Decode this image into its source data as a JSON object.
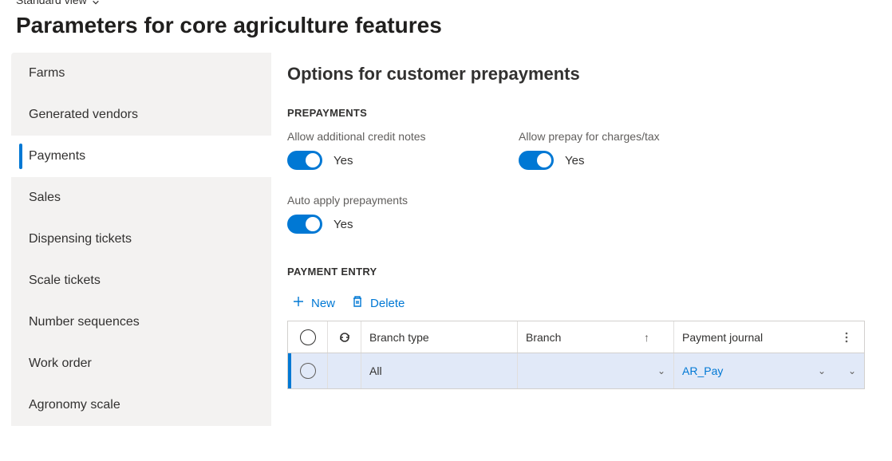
{
  "view_mode": "Standard view",
  "page_title": "Parameters for core agriculture features",
  "sidebar": {
    "items": [
      {
        "label": "Farms"
      },
      {
        "label": "Generated vendors"
      },
      {
        "label": "Payments"
      },
      {
        "label": "Sales"
      },
      {
        "label": "Dispensing tickets"
      },
      {
        "label": "Scale tickets"
      },
      {
        "label": "Number sequences"
      },
      {
        "label": "Work order"
      },
      {
        "label": "Agronomy scale"
      }
    ],
    "active_index": 2
  },
  "main": {
    "title": "Options for customer prepayments",
    "sections": {
      "prepayments": {
        "label": "PREPAYMENTS",
        "toggles": {
          "allow_credit_notes": {
            "label": "Allow additional credit notes",
            "value": "Yes",
            "on": true
          },
          "allow_prepay_charges": {
            "label": "Allow prepay for charges/tax",
            "value": "Yes",
            "on": true
          },
          "auto_apply": {
            "label": "Auto apply prepayments",
            "value": "Yes",
            "on": true
          }
        }
      },
      "payment_entry": {
        "label": "PAYMENT ENTRY",
        "toolbar": {
          "new_label": "New",
          "delete_label": "Delete"
        },
        "columns": {
          "col1": "Branch type",
          "col2": "Branch",
          "col3": "Payment journal"
        },
        "rows": [
          {
            "branch_type": "All",
            "branch": "",
            "payment_journal": "AR_Pay"
          }
        ]
      }
    }
  }
}
